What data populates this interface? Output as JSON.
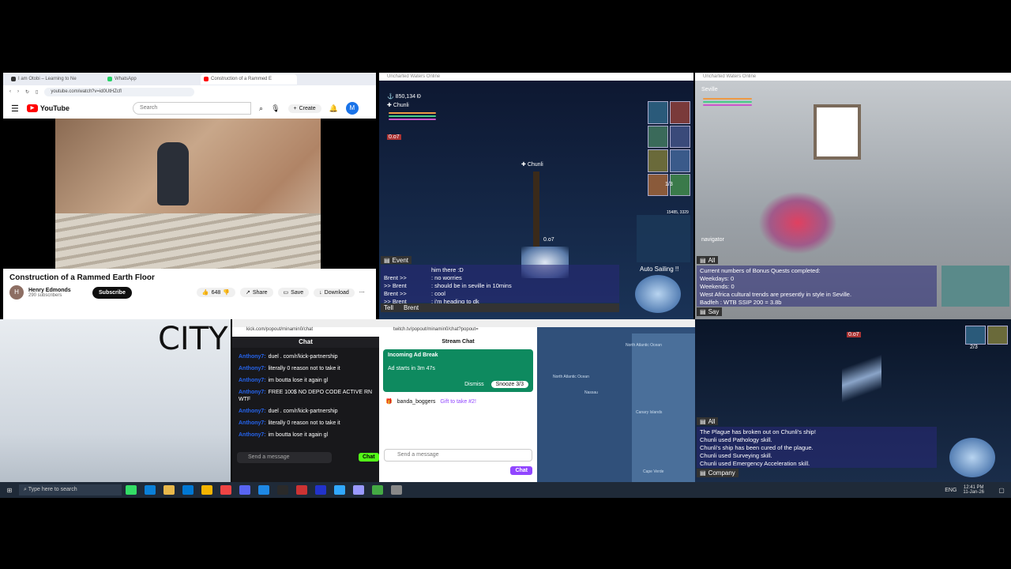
{
  "youtube": {
    "tabs": [
      "I am Otobi – Learning to Ne",
      "WhatsApp",
      "Construction of a Rammed E"
    ],
    "url": "youtube.com/watch?v=id0UtHZcfl",
    "logo": "YouTube",
    "search_placeholder": "Search",
    "create_label": "Create",
    "avatar_letter": "M",
    "video_title": "Construction of a Rammed Earth Floor",
    "channel_name": "Henry Edmonds",
    "subscribers": "290 subscribers",
    "channel_initial": "H",
    "subscribe_label": "Subscribe",
    "likes": "648",
    "share_label": "Share",
    "save_label": "Save",
    "download_label": "Download"
  },
  "game1": {
    "window_title": "Uncharted Waters Online",
    "gold": "850,134",
    "player_name": "Chunli",
    "ship_name": "Chunli",
    "fleet_label": "0.o7",
    "page_indicator": "1/3",
    "coords": "15485, 3329",
    "auto_sailing": "Auto Sailing !!",
    "event_tab": "Event",
    "tell_tab": "Tell",
    "tell_target": "Brent",
    "chat_lines": [
      {
        "who": "",
        "msg": "him there :D"
      },
      {
        "who": "Brent >>",
        "msg": ": no worries"
      },
      {
        "who": ">> Brent",
        "msg": ": should be in seville in 10mins"
      },
      {
        "who": "Brent >>",
        "msg": ": cool"
      },
      {
        "who": ">> Brent",
        "msg": ": i'm heading to dk"
      }
    ]
  },
  "game2": {
    "window_title": "Uncharted Waters Online",
    "location": "Seville",
    "npc_label": "navigator",
    "all_tab": "All",
    "say_tab": "Say",
    "chat_lines": [
      "Current numbers of Bonus Quests completed:",
      "Weekdays: 0",
      "Weekends: 0",
      "West Africa cultural trends are presently in style in Seville.",
      "Badfeh        : WTB SSIP 200 = 3.8b"
    ]
  },
  "game3": {
    "fleet_label": "0.o7",
    "page_indicator": "2/3",
    "all_tab": "All",
    "company_tab": "Company",
    "chat_lines": [
      "The Plague has broken out on Chunli's ship!",
      "Chunli used Pathology skill.",
      "Chunli's ship has been cured of the plague.",
      "Chunli used Surveying skill.",
      "Chunli used Emergency Acceleration skill."
    ]
  },
  "twitch_kick": {
    "url": "kick.com/popout/minamin0/chat",
    "header": "Chat",
    "lines": [
      {
        "user": "Anthony7:",
        "msg": "duel . com/r/kick-partnership"
      },
      {
        "user": "Anthony7:",
        "msg": "literally 0 reason not to take it"
      },
      {
        "user": "Anthony7:",
        "msg": "im boutta lose it again gl"
      },
      {
        "user": "Anthony7:",
        "msg": "FREE 100$ NO DEPO CODE ACTIVE RN WTF"
      },
      {
        "user": "Anthony7:",
        "msg": "duel . com/r/kick-partnership"
      },
      {
        "user": "Anthony7:",
        "msg": "literally 0 reason not to take it"
      },
      {
        "user": "Anthony7:",
        "msg": "im boutta lose it again gl"
      }
    ],
    "input_placeholder": "Send a message",
    "chat_button": "Chat"
  },
  "twitch": {
    "url": "twitch.tv/popout/minamin0/chat?popout=",
    "header": "Stream Chat",
    "ad_title": "Incoming Ad Break",
    "ad_text": "Ad starts in 3m 47s",
    "dismiss": "Dismiss",
    "snooze": "Snooze 3/3",
    "gifter": "banda_boggers",
    "gift_text": "Gift to take #2!",
    "input_placeholder": "Send a message",
    "chat_button": "Chat"
  },
  "map": {
    "labels": [
      "North Atlantic Ocean",
      "Nassau",
      "North Atlantic Ocean",
      "Canary Islands",
      "Cape Verde"
    ]
  },
  "desktop_text": "CITY",
  "taskbar": {
    "search_placeholder": "Type here to search",
    "time": "12:41 PM",
    "date": "11-Jan-26",
    "lang": "ENG"
  },
  "colors": {
    "yt_red": "#ff0000",
    "twitch_purple": "#9146ff",
    "kick_green": "#53fc18",
    "ad_green": "#0e8a5f"
  }
}
